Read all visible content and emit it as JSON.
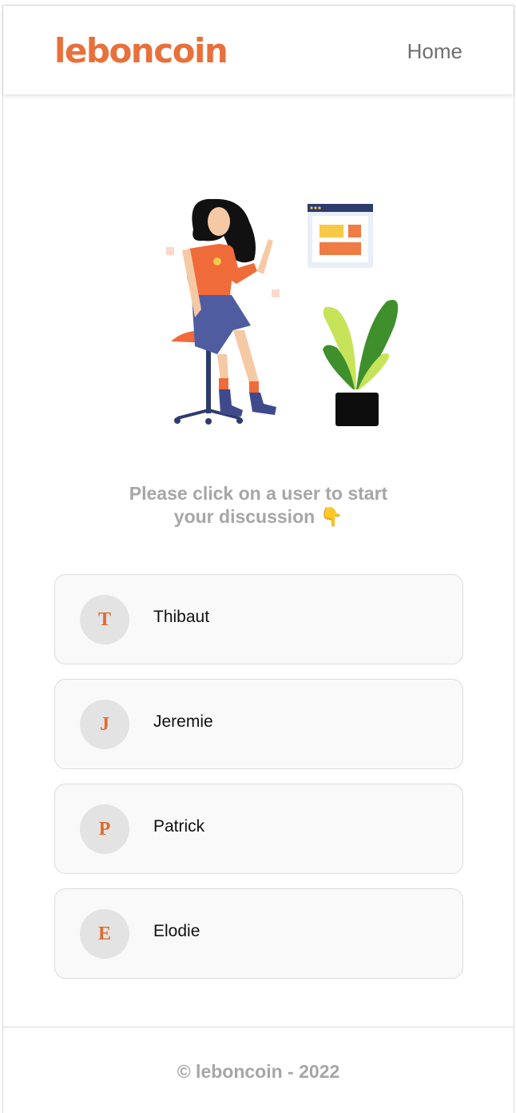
{
  "header": {
    "logo_text": "leboncoin",
    "nav_home_label": "Home"
  },
  "illustration": {
    "icon": "woman-on-stool-with-plant-illustration"
  },
  "prompt": {
    "line1": "Please click on a user to start",
    "line2": "your discussion 👇"
  },
  "users": [
    {
      "initial": "T",
      "name": "Thibaut"
    },
    {
      "initial": "J",
      "name": "Jeremie"
    },
    {
      "initial": "P",
      "name": "Patrick"
    },
    {
      "initial": "E",
      "name": "Elodie"
    }
  ],
  "footer": {
    "copyright": "© leboncoin - 2022"
  },
  "colors": {
    "brand": "#e8703a",
    "muted_text": "#a6a6a6",
    "card_bg": "#f9f9f9",
    "avatar_bg": "#e3e3e3"
  }
}
